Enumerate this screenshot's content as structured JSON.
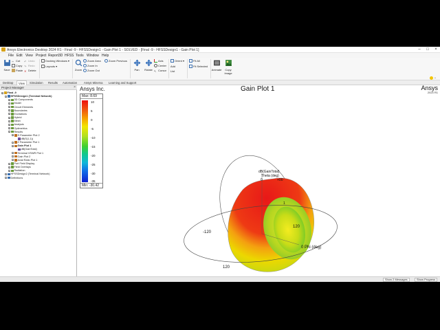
{
  "window": {
    "title": "Ansys Electronics Desktop 2024 R1 - Final -9 - HFSSDesign1 - Gain Plot 1 - SOLVED - [Final -9 - HFSSDesign1 - Gain Plot 1]"
  },
  "menu": [
    "File",
    "Edit",
    "View",
    "Project",
    "Report3D",
    "HFSS",
    "Tools",
    "Window",
    "Help"
  ],
  "ribbon": {
    "save": "Save",
    "cut": "Cut",
    "copy": "Copy",
    "paste": "Paste",
    "undo": "Undo",
    "redo": "Redo",
    "delete": "Delete",
    "docking_windows": "Docking Windows",
    "layouts": "Layouts",
    "zoom": "Zoom",
    "zoom_area": "Zoom Area",
    "zoom_in": "Zoom In",
    "zoom_out": "Zoom Out",
    "zoom_previous": "Zoom Previous",
    "pan": "Pan",
    "rotate": "Rotate",
    "axis": "Axis",
    "center": "Center",
    "cursor": "Cursor",
    "orient": "Orient",
    "add": "Add",
    "list": "List",
    "fit_all": "Fit All",
    "fit_selected": "Fit Selected",
    "animate": "Animate",
    "copy_image": "Copy Image"
  },
  "tabs": [
    "Desktop",
    "View",
    "Simulation",
    "Results",
    "Automation",
    "Ansys Minerva",
    "Learning and Support"
  ],
  "project_manager": {
    "title": "Project Manager",
    "items": [
      {
        "label": "Final -9",
        "level": 0,
        "bold": true
      },
      {
        "label": "HFSSDesign1 (Terminal Network)",
        "level": 1,
        "bold": true
      },
      {
        "label": "3D Components",
        "level": 2
      },
      {
        "label": "Model",
        "level": 2
      },
      {
        "label": "Circuit Elements",
        "level": 2
      },
      {
        "label": "Boundaries",
        "level": 2
      },
      {
        "label": "Excitations",
        "level": 2
      },
      {
        "label": "Hybrid",
        "level": 2
      },
      {
        "label": "Mesh",
        "level": 2
      },
      {
        "label": "Analysis",
        "level": 2
      },
      {
        "label": "Optimetrics",
        "level": 2
      },
      {
        "label": "Results",
        "level": 2
      },
      {
        "label": "S Parameter Plot 2",
        "level": 3
      },
      {
        "label": "dB(S(1,1))",
        "level": 4
      },
      {
        "label": "Z Parameter Plot 1",
        "level": 3
      },
      {
        "label": "Gain Plot 1",
        "level": 3,
        "bold": true
      },
      {
        "label": "dB(GainTotal)",
        "level": 4
      },
      {
        "label": "Terminal VSWR Plot 1",
        "level": 3
      },
      {
        "label": "Gain Plot 2",
        "level": 3
      },
      {
        "label": "Axial Ratio Plot 1",
        "level": 3
      },
      {
        "label": "Port Field Display",
        "level": 2
      },
      {
        "label": "Field Overlays",
        "level": 2
      },
      {
        "label": "Radiation",
        "level": 2
      },
      {
        "label": "HFSSDesign2 (Terminal Network)",
        "level": 1
      },
      {
        "label": "Definitions",
        "level": 1
      }
    ]
  },
  "viewport": {
    "brand_left": "Ansys Inc.",
    "brand_right": "Ansys",
    "brand_right_sub": "2024 R1",
    "plot_title": "Gain Plot 1"
  },
  "legend": {
    "max_label": "Max: 8.69",
    "min_label": "Min: -30.42",
    "ticks": [
      "10",
      "5",
      "0",
      "-5",
      "-10",
      "-15",
      "-20",
      "-25",
      "-30",
      "-35"
    ]
  },
  "plot_labels": {
    "quantity": "dB(GainTotal)",
    "theta": "Theta (deg)",
    "zero": "0",
    "phi": "0  Phi (deg)",
    "minus120": "-120",
    "plus120": "120",
    "bottom120": "120",
    "one": "1",
    "e00": "+00"
  },
  "statusbar": {
    "messages": "Show 2 Messages",
    "progress": "Show Progress"
  },
  "colors": {
    "gain_high": "#e81818",
    "gain_mid": "#f0d800",
    "gain_low": "#7cc828"
  }
}
